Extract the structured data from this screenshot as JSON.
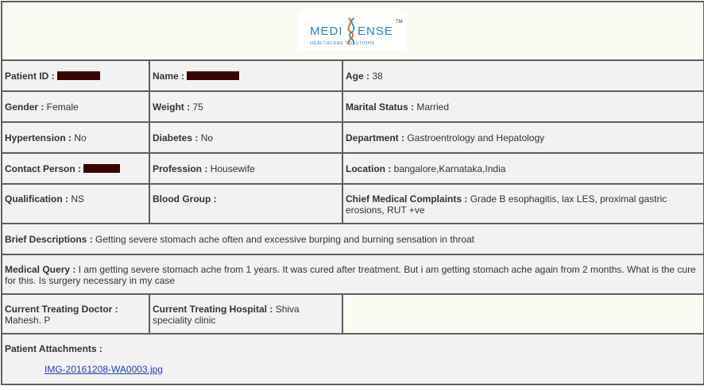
{
  "logo": {
    "brand_left": "MEDI",
    "brand_right": "ENSE",
    "tm": "TM",
    "tagline": "HEALTHCARE SOLUTIONS"
  },
  "fields": {
    "patient_id_label": "Patient ID :",
    "name_label": "Name :",
    "age_label": "Age :",
    "age_value": " 38",
    "gender_label": "Gender :",
    "gender_value": " Female",
    "weight_label": "Weight :",
    "weight_value": " 75",
    "marital_label": "Marital Status :",
    "marital_value": " Married",
    "hypertension_label": "Hypertension :",
    "hypertension_value": " No",
    "diabetes_label": "Diabetes :",
    "diabetes_value": " No",
    "department_label": "Department :",
    "department_value": " Gastroentrology and Hepatology",
    "contact_label": "Contact Person :",
    "profession_label": "Profession :",
    "profession_value": " Housewife",
    "location_label": "Location :",
    "location_value": " bangalore,Karnataka,India",
    "qualification_label": "Qualification :",
    "qualification_value": " NS",
    "blood_group_label": "Blood Group :",
    "blood_group_value": "",
    "complaints_label": "Chief Medical Complaints :",
    "complaints_value": " Grade B esophagitis, lax LES, proximal gastric erosions, RUT +ve",
    "brief_label": "Brief Descriptions :",
    "brief_value": " Getting severe stomach ache often and excessive burping and burning sensation in throat",
    "query_label": "Medical Query :",
    "query_value": " I am getting severe stomach ache from 1 years. It was cured after treatment. But i am getting stomach ache again from 2 months. What is the cure for this. Is surgery necessary in my case",
    "doctor_label": "Current Treating Doctor :",
    "doctor_value": "Mahesh. P",
    "hospital_label": "Current Treating Hospital :",
    "hospital_value": " Shiva speciality clinic",
    "attachments_label": "Patient Attachments :",
    "attachment_file": "IMG-20161208-WA0003.jpg"
  }
}
